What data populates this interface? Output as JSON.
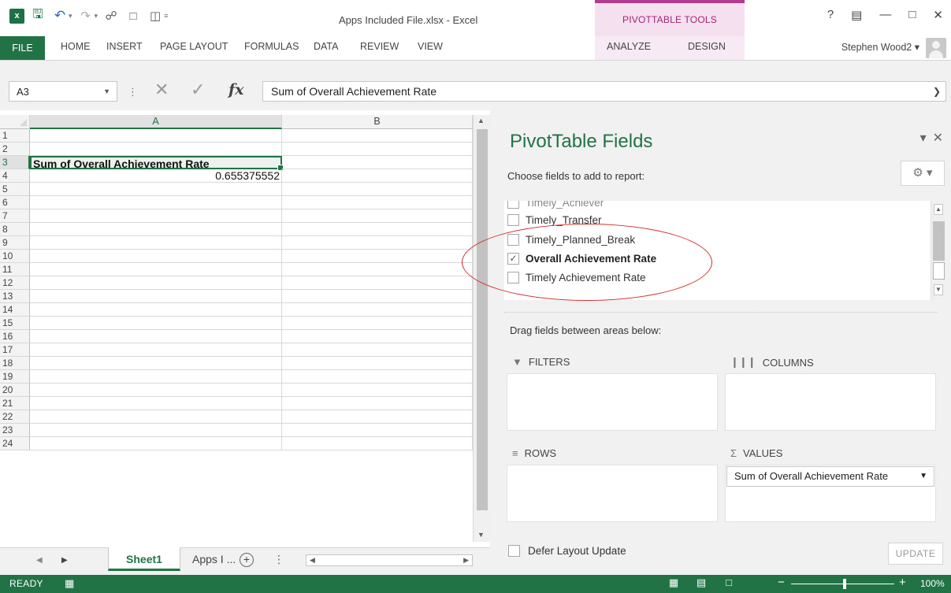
{
  "window": {
    "title": "Apps Included File.xlsx - Excel",
    "context_tools": "PIVOTTABLE TOOLS",
    "accent": "#217346",
    "context_accent": "#a32579"
  },
  "ribbon": {
    "tabs": [
      {
        "label": "FILE"
      },
      {
        "label": "HOME"
      },
      {
        "label": "INSERT"
      },
      {
        "label": "PAGE LAYOUT"
      },
      {
        "label": "FORMULAS"
      },
      {
        "label": "DATA"
      },
      {
        "label": "REVIEW"
      },
      {
        "label": "VIEW"
      },
      {
        "label": "ANALYZE"
      },
      {
        "label": "DESIGN"
      }
    ],
    "user": "Stephen Wood2 ▾"
  },
  "formula_bar": {
    "name_box": "A3",
    "fx": "fx",
    "content": "Sum of Overall Achievement Rate"
  },
  "grid": {
    "columns": [
      "A",
      "B"
    ],
    "active_cell": "A3",
    "rows": [
      {
        "n": "1",
        "a": "",
        "b": ""
      },
      {
        "n": "2",
        "a": "",
        "b": ""
      },
      {
        "n": "3",
        "a": "Sum of Overall Achievement Rate",
        "b": ""
      },
      {
        "n": "4",
        "a": "0.655375552",
        "b": ""
      },
      {
        "n": "5",
        "a": "",
        "b": ""
      },
      {
        "n": "6",
        "a": "",
        "b": ""
      },
      {
        "n": "7",
        "a": "",
        "b": ""
      },
      {
        "n": "8",
        "a": "",
        "b": ""
      },
      {
        "n": "9",
        "a": "",
        "b": ""
      },
      {
        "n": "10",
        "a": "",
        "b": ""
      },
      {
        "n": "11",
        "a": "",
        "b": ""
      },
      {
        "n": "12",
        "a": "",
        "b": ""
      },
      {
        "n": "13",
        "a": "",
        "b": ""
      },
      {
        "n": "14",
        "a": "",
        "b": ""
      },
      {
        "n": "15",
        "a": "",
        "b": ""
      },
      {
        "n": "16",
        "a": "",
        "b": ""
      },
      {
        "n": "17",
        "a": "",
        "b": ""
      },
      {
        "n": "18",
        "a": "",
        "b": ""
      },
      {
        "n": "19",
        "a": "",
        "b": ""
      },
      {
        "n": "20",
        "a": "",
        "b": ""
      },
      {
        "n": "21",
        "a": "",
        "b": ""
      },
      {
        "n": "22",
        "a": "",
        "b": ""
      },
      {
        "n": "23",
        "a": "",
        "b": ""
      },
      {
        "n": "24",
        "a": "",
        "b": ""
      }
    ]
  },
  "sheets": {
    "tabs": [
      {
        "label": "Sheet1",
        "active": true
      },
      {
        "label": "Apps I ...",
        "active": false
      }
    ],
    "add": "+"
  },
  "pivot": {
    "title": "PivotTable Fields",
    "choose_label": "Choose fields to add to report:",
    "fields": [
      {
        "label": "Timely_Achiever",
        "checked": false
      },
      {
        "label": "Timely_Transfer",
        "checked": false
      },
      {
        "label": "Timely_Planned_Break",
        "checked": false
      },
      {
        "label": "Overall Achievement Rate",
        "checked": true
      },
      {
        "label": "Timely Achievement Rate",
        "checked": false
      }
    ],
    "drag_label": "Drag fields between areas below:",
    "areas": {
      "filters": "FILTERS",
      "columns": "COLUMNS",
      "rows": "ROWS",
      "values": "VALUES"
    },
    "value_item": "Sum of Overall Achievement Rate",
    "defer_label": "Defer Layout Update",
    "update_label": "UPDATE"
  },
  "status": {
    "ready": "READY",
    "zoom": "100%"
  }
}
